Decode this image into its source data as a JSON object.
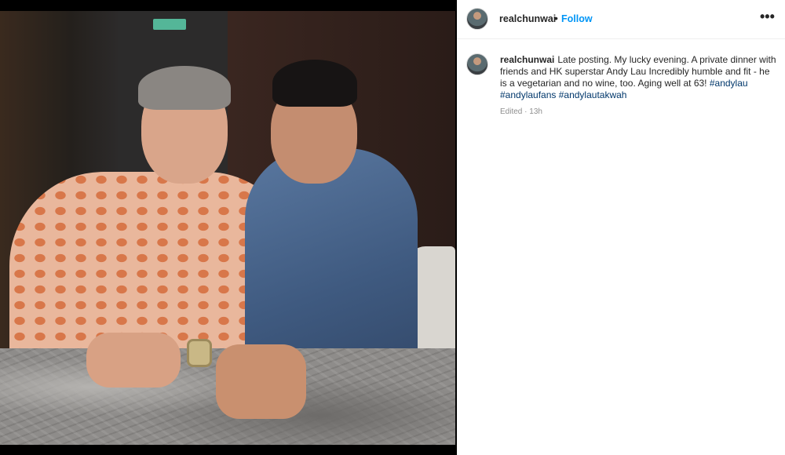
{
  "post": {
    "photo_alt": "",
    "username": "realchunwai",
    "separator": "•",
    "follow_label": "Follow",
    "more_icon": "•••",
    "caption_text": "Late posting. My lucky evening. A private dinner with friends and HK superstar Andy Lau Incredibly humble and fit - he is a vegetarian and no wine, too. Aging well at 63!",
    "hashtags": [
      "#andylau",
      "#andylaufans",
      "#andylautakwah"
    ],
    "edited_label": "Edited",
    "meta_separator": "·",
    "time_ago": "13h"
  },
  "colors": {
    "link_blue": "#0095f6",
    "hashtag_blue": "#00376b",
    "meta_gray": "#8e8e8e"
  },
  "icons": {
    "avatar": "profile-avatar-icon",
    "more": "more-options-icon"
  }
}
